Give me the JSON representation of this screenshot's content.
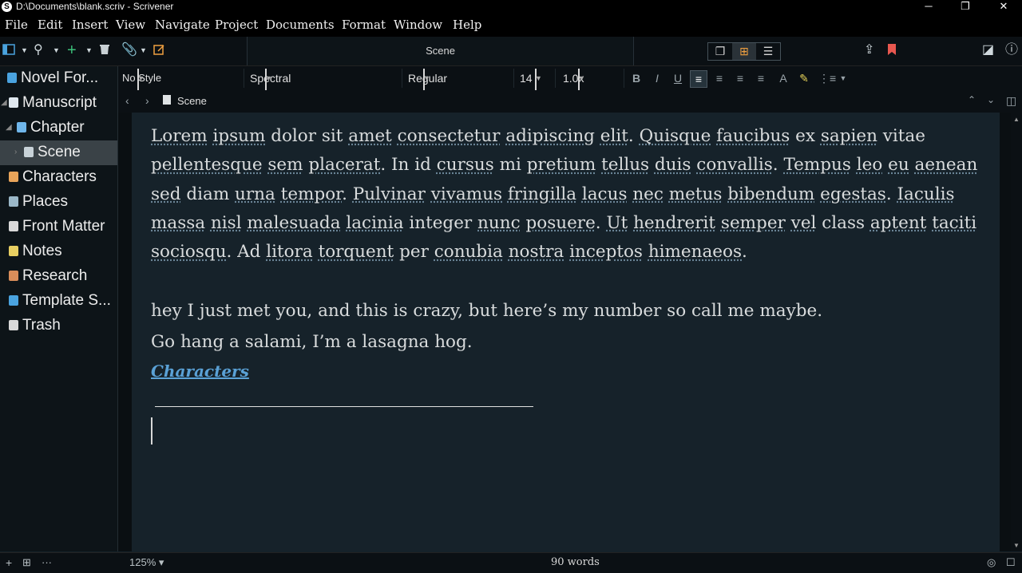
{
  "window": {
    "title": "D:\\Documents\\blank.scriv - Scrivener",
    "app_icon": "S",
    "controls": [
      "─",
      "❐",
      "✕"
    ]
  },
  "menu": [
    "File",
    "Edit",
    "Insert",
    "View",
    "Navigate",
    "Project",
    "Documents",
    "Format",
    "Window",
    "Help"
  ],
  "toolbar": {
    "doc_title": "Scene"
  },
  "format": {
    "style": "No Style",
    "font": "Spectral",
    "weight": "Regular",
    "size": "14",
    "spacing": "1.0x"
  },
  "binder": [
    {
      "label": "Novel For...",
      "icon": "novel-format-icon",
      "color": "#4aa3df"
    },
    {
      "label": "Manuscript",
      "icon": "manuscript-icon",
      "color": "#dfe8ef"
    },
    {
      "label": "Chapter",
      "icon": "chapter-icon",
      "color": "#6fb6ea"
    },
    {
      "label": "Scene",
      "icon": "scene-icon",
      "color": "#c8d2d8"
    },
    {
      "label": "Characters",
      "icon": "characters-icon",
      "color": "#e8a45a"
    },
    {
      "label": "Places",
      "icon": "places-icon",
      "color": "#9bb8c8"
    },
    {
      "label": "Front Matter",
      "icon": "front-matter-icon",
      "color": "#d9d9d9"
    },
    {
      "label": "Notes",
      "icon": "notes-icon",
      "color": "#e8cf62"
    },
    {
      "label": "Research",
      "icon": "research-icon",
      "color": "#d98d5a"
    },
    {
      "label": "Template S...",
      "icon": "template-sheets-icon",
      "color": "#4aa3df"
    },
    {
      "label": "Trash",
      "icon": "trash-icon",
      "color": "#d9d9d9"
    }
  ],
  "navbar": {
    "doc_title": "Scene"
  },
  "editor": {
    "paragraph1": [
      {
        "t": "Lorem",
        "u": true
      },
      {
        "t": " "
      },
      {
        "t": "ipsum",
        "u": true
      },
      {
        "t": " dolor sit "
      },
      {
        "t": "amet",
        "u": true
      },
      {
        "t": " "
      },
      {
        "t": "consectetur",
        "u": true
      },
      {
        "t": " "
      },
      {
        "t": "adipiscing",
        "u": true
      },
      {
        "t": " "
      },
      {
        "t": "elit",
        "u": true
      },
      {
        "t": ". "
      },
      {
        "t": "Quisque",
        "u": true
      },
      {
        "t": " "
      },
      {
        "t": "faucibus",
        "u": true
      },
      {
        "t": " ex "
      },
      {
        "t": "sapien",
        "u": true
      },
      {
        "t": " vitae "
      },
      {
        "t": "pellentesque",
        "u": true
      },
      {
        "t": " "
      },
      {
        "t": "sem",
        "u": true
      },
      {
        "t": " "
      },
      {
        "t": "placerat",
        "u": true
      },
      {
        "t": ". In id "
      },
      {
        "t": "cursus",
        "u": true
      },
      {
        "t": " mi "
      },
      {
        "t": "pretium",
        "u": true
      },
      {
        "t": " "
      },
      {
        "t": "tellus",
        "u": true
      },
      {
        "t": " "
      },
      {
        "t": "duis",
        "u": true
      },
      {
        "t": " "
      },
      {
        "t": "convallis",
        "u": true
      },
      {
        "t": ". "
      },
      {
        "t": "Tempus",
        "u": true
      },
      {
        "t": " "
      },
      {
        "t": "leo",
        "u": true
      },
      {
        "t": " "
      },
      {
        "t": "eu",
        "u": true
      },
      {
        "t": " "
      },
      {
        "t": "aenean",
        "u": true
      },
      {
        "t": " "
      },
      {
        "t": "sed",
        "u": true
      },
      {
        "t": " diam "
      },
      {
        "t": "urna",
        "u": true
      },
      {
        "t": " "
      },
      {
        "t": "tempor",
        "u": true
      },
      {
        "t": ". "
      },
      {
        "t": "Pulvinar",
        "u": true
      },
      {
        "t": " "
      },
      {
        "t": "vivamus",
        "u": true
      },
      {
        "t": " "
      },
      {
        "t": "fringilla",
        "u": true
      },
      {
        "t": " "
      },
      {
        "t": "lacus",
        "u": true
      },
      {
        "t": " "
      },
      {
        "t": "nec",
        "u": true
      },
      {
        "t": " "
      },
      {
        "t": "metus",
        "u": true
      },
      {
        "t": " "
      },
      {
        "t": "bibendum",
        "u": true
      },
      {
        "t": " "
      },
      {
        "t": "egestas",
        "u": true
      },
      {
        "t": ". "
      },
      {
        "t": "Iaculis",
        "u": true
      },
      {
        "t": " "
      },
      {
        "t": "massa",
        "u": true
      },
      {
        "t": " "
      },
      {
        "t": "nisl",
        "u": true
      },
      {
        "t": " "
      },
      {
        "t": "malesuada",
        "u": true
      },
      {
        "t": " "
      },
      {
        "t": "lacinia",
        "u": true
      },
      {
        "t": " integer "
      },
      {
        "t": "nunc",
        "u": true
      },
      {
        "t": " "
      },
      {
        "t": "posuere",
        "u": true
      },
      {
        "t": ". "
      },
      {
        "t": "Ut",
        "u": true
      },
      {
        "t": " "
      },
      {
        "t": "hendrerit",
        "u": true
      },
      {
        "t": " "
      },
      {
        "t": "semper",
        "u": true
      },
      {
        "t": " "
      },
      {
        "t": "vel",
        "u": true
      },
      {
        "t": " class "
      },
      {
        "t": "aptent",
        "u": true
      },
      {
        "t": " "
      },
      {
        "t": "taciti",
        "u": true
      },
      {
        "t": " "
      },
      {
        "t": "sociosqu",
        "u": true
      },
      {
        "t": ". Ad "
      },
      {
        "t": "litora",
        "u": true
      },
      {
        "t": " "
      },
      {
        "t": "torquent",
        "u": true
      },
      {
        "t": " "
      },
      {
        "t": "per "
      },
      {
        "t": "conubia",
        "u": true
      },
      {
        "t": " "
      },
      {
        "t": "nostra",
        "u": true
      },
      {
        "t": " "
      },
      {
        "t": "inceptos",
        "u": true
      },
      {
        "t": " "
      },
      {
        "t": "himenaeos",
        "u": true
      },
      {
        "t": "."
      }
    ],
    "line2": "hey I just met you, and this is crazy, but here’s my number so call me maybe.",
    "line3": "Go hang a salami, I’m a lasagna hog.",
    "link": "Characters"
  },
  "status": {
    "zoom": "125%",
    "word_count": "90 words"
  },
  "colors": {
    "accent_orange": "#f0a040",
    "bookmark_red": "#e8574f",
    "link_blue": "#5aa1d6",
    "add_green": "#3cc07a"
  }
}
